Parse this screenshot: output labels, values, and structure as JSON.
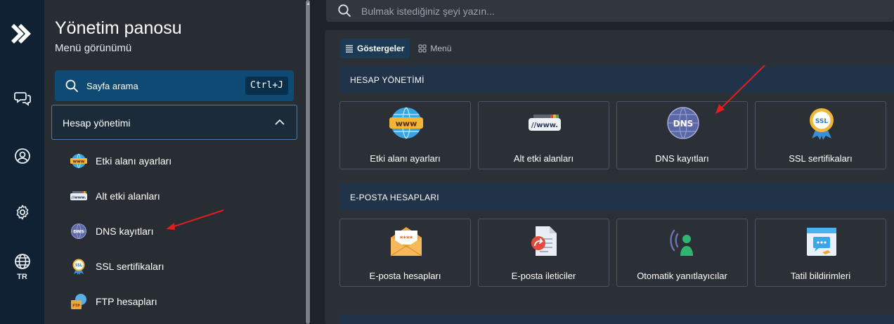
{
  "rail": {
    "lang": "TR"
  },
  "sidebar": {
    "title": "Yönetim panosu",
    "subtitle": "Menü görünümü",
    "search_label": "Sayfa arama",
    "shortcut": "Ctrl+J",
    "group_label": "Hesap yönetimi",
    "items": [
      {
        "label": "Etki alanı ayarları"
      },
      {
        "label": "Alt etki alanları"
      },
      {
        "label": "DNS kayıtları"
      },
      {
        "label": "SSL sertifikaları"
      },
      {
        "label": "FTP hesapları"
      }
    ]
  },
  "main": {
    "search_placeholder": "Bulmak istediğiniz şeyi yazın...",
    "tabs": [
      {
        "label": "Göstergeler"
      },
      {
        "label": "Menü"
      }
    ],
    "sections": [
      {
        "title": "HESAP YÖNETİMİ",
        "cards": [
          {
            "label": "Etki alanı ayarları"
          },
          {
            "label": "Alt etki alanları"
          },
          {
            "label": "DNS kayıtları"
          },
          {
            "label": "SSL sertifikaları"
          }
        ]
      },
      {
        "title": "E-POSTA HESAPLARI",
        "cards": [
          {
            "label": "E-posta hesapları"
          },
          {
            "label": "E-posta ileticiler"
          },
          {
            "label": "Otomatik yanıtlayıcılar"
          },
          {
            "label": "Tatil bildirimleri"
          }
        ]
      }
    ]
  },
  "icons": {
    "www": "www-globe-icon",
    "subdomain": "www-bar-icon",
    "dns": "dns-globe-icon",
    "ssl": "ssl-badge-icon",
    "ftp": "ftp-icon",
    "mail": "envelope-icon",
    "forwarder": "document-forward-icon",
    "autoresponder": "person-signal-icon",
    "vacation": "calendar-chat-icon"
  },
  "colors": {
    "accent": "#0e4a73",
    "section_header": "#213349",
    "annotation_arrow": "#e01e1e"
  }
}
